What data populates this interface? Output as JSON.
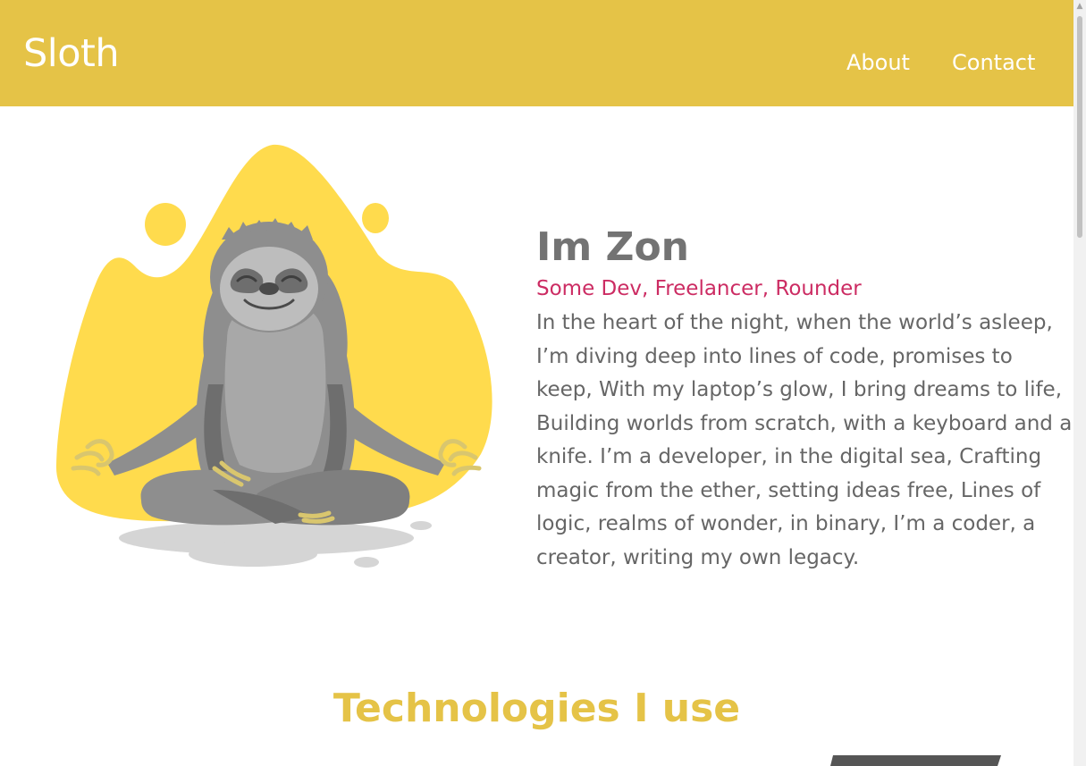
{
  "nav": {
    "brand": "Sloth",
    "links": [
      {
        "label": "About"
      },
      {
        "label": "Contact"
      }
    ]
  },
  "hero": {
    "name": "Im Zon",
    "role": "Some Dev, Freelancer, Rounder",
    "bio": "In the heart of the night, when the world’s asleep, I’m diving deep into lines of code, promises to keep, With my laptop’s glow, I bring dreams to life, Building worlds from scratch, with a keyboard and a knife. I’m a developer, in the digital sea, Crafting magic from the ether, setting ideas free, Lines of logic, realms of wonder, in binary, I’m a coder, a creator, writing my own legacy."
  },
  "technologies": {
    "title": "Technologies I use"
  },
  "colors": {
    "header": "#e5c347",
    "title_accent": "#e5c347",
    "role_accent": "#cc2c63",
    "text": "#666666"
  },
  "icons": [
    "sloth-illustration",
    "scroll-up-icon"
  ]
}
